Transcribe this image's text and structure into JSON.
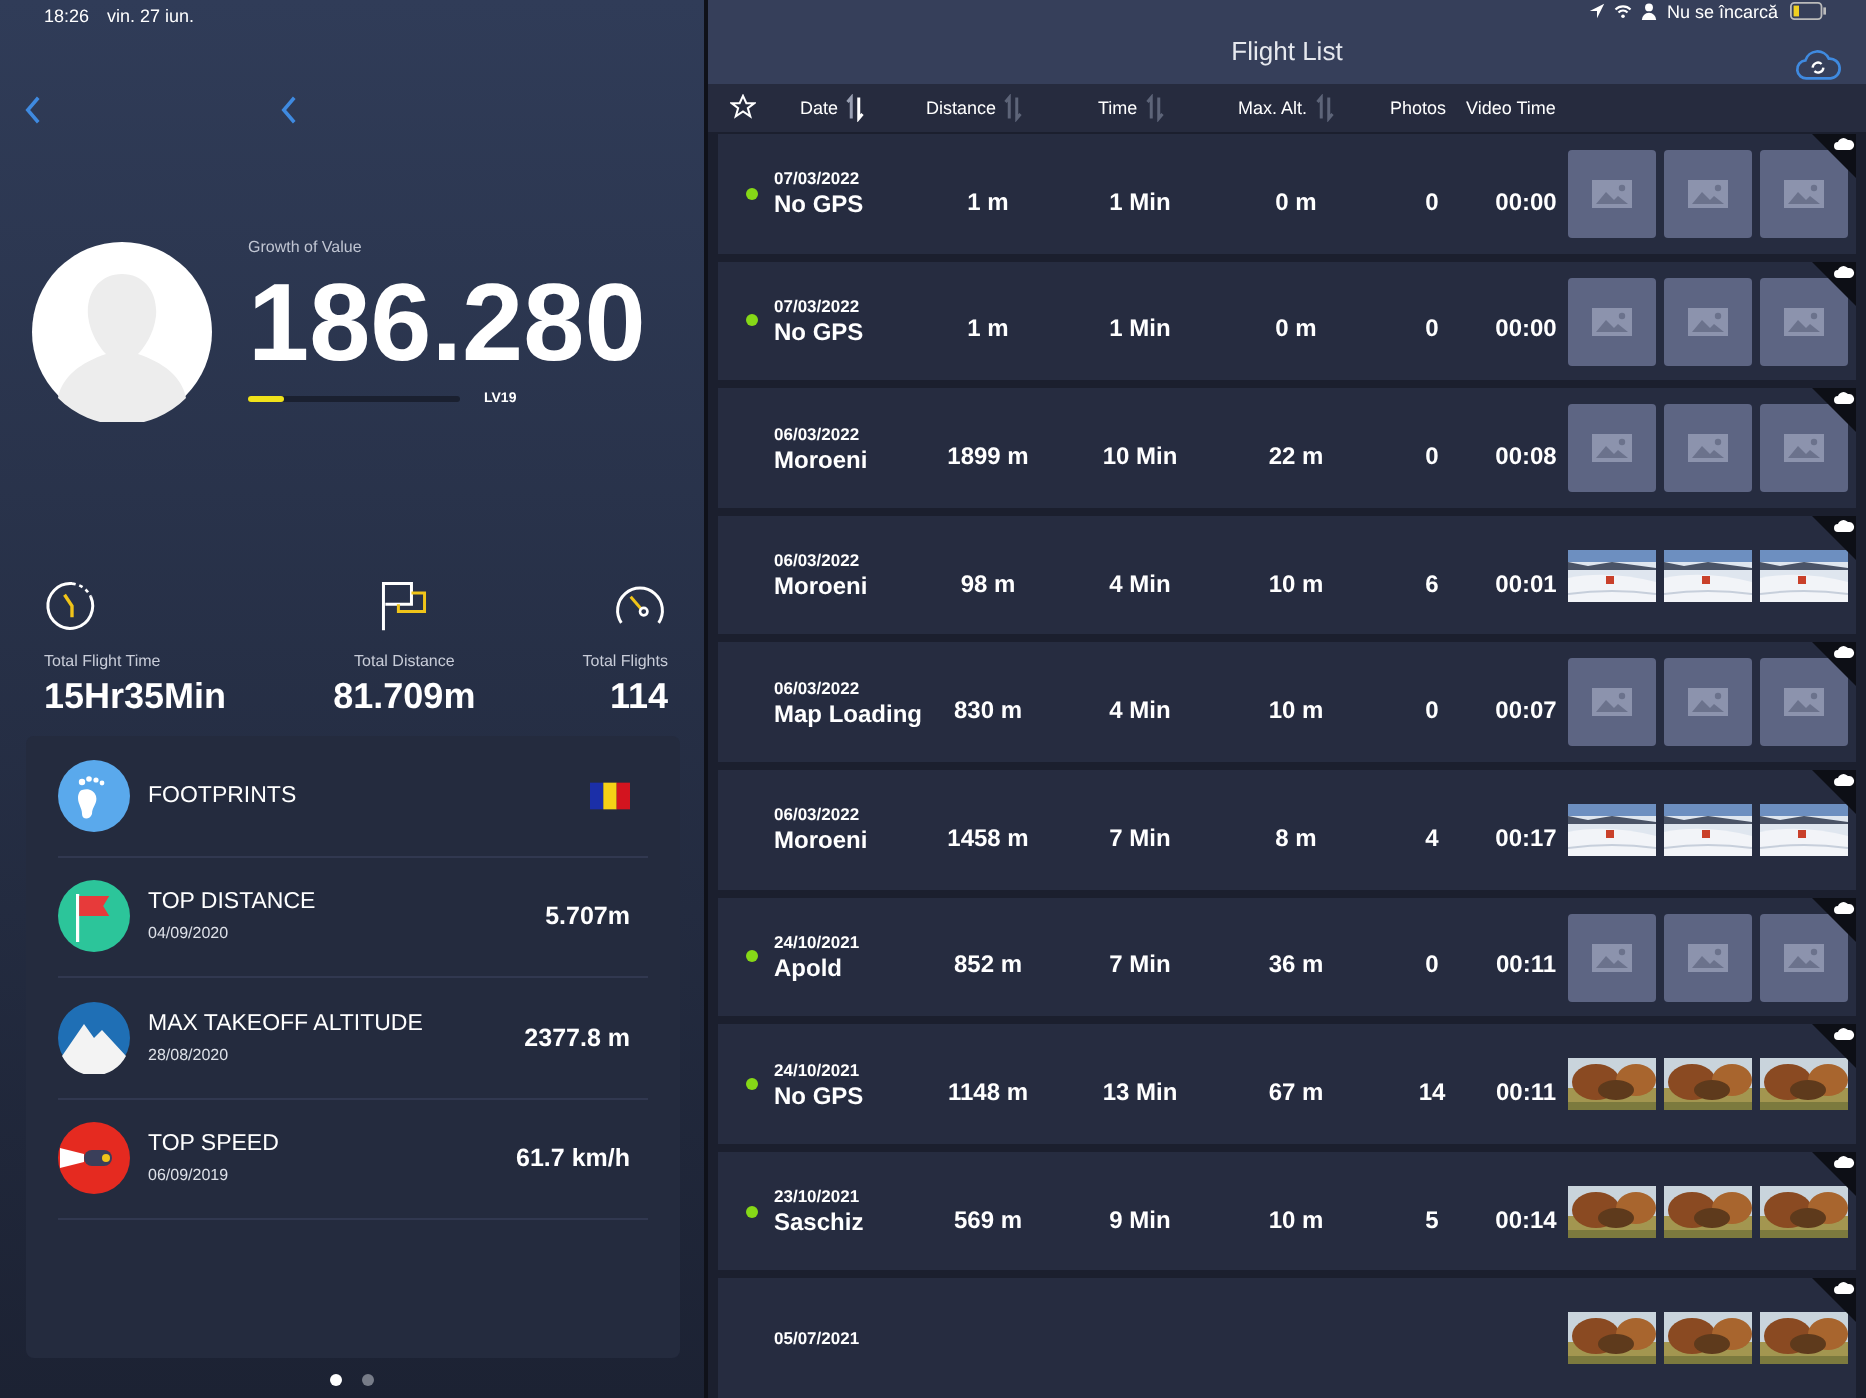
{
  "status_bar": {
    "time": "18:26",
    "date": "vin. 27 iun.",
    "charging": "Nu se încarcă"
  },
  "profile": {
    "caption": "Growth of Value",
    "value": "186.280",
    "level": 0.17,
    "rank": "LV19"
  },
  "stats": [
    {
      "kind": "time",
      "label": "Total Flight Time",
      "value": "15Hr35Min"
    },
    {
      "kind": "distance",
      "label": "Total Distance",
      "value": "81.709m"
    },
    {
      "kind": "flights",
      "label": "Total Flights",
      "value": "114"
    }
  ],
  "records": [
    {
      "kind": "footprints",
      "title": "FOOTPRINTS"
    },
    {
      "kind": "distance",
      "title": "TOP DISTANCE",
      "date": "04/09/2020",
      "value": "5.707m"
    },
    {
      "kind": "altitude",
      "title": "MAX TAKEOFF ALTITUDE",
      "date": "28/08/2020",
      "value": "2377.8 m"
    },
    {
      "kind": "speed",
      "title": "TOP SPEED",
      "date": "06/09/2019",
      "value": "61.7 km/h"
    }
  ],
  "pager": [
    {
      "selected": true
    },
    {
      "selected": false
    }
  ],
  "flight_list": {
    "title": "Flight List",
    "columns": [
      {
        "label": "Date",
        "sortable": true,
        "sorted": true
      },
      {
        "label": "Distance",
        "sortable": true,
        "sorted": false
      },
      {
        "label": "Time",
        "sortable": true,
        "sorted": false
      },
      {
        "label": "Max. Alt.",
        "sortable": true,
        "sorted": false
      },
      {
        "label": "Photos"
      },
      {
        "label": "Video Time"
      }
    ],
    "rows": [
      {
        "date": "07/03/2022",
        "place": "No GPS",
        "gps": true,
        "distance": "1 m",
        "time": "1 Min",
        "alt": "0 m",
        "photos": "0",
        "video": "00:00",
        "thumbs": [
          {
            "photo": false
          },
          {
            "photo": false
          },
          {
            "photo": false
          }
        ]
      },
      {
        "date": "07/03/2022",
        "place": "No GPS",
        "gps": true,
        "distance": "1 m",
        "time": "1 Min",
        "alt": "0 m",
        "photos": "0",
        "video": "00:00",
        "thumbs": [
          {
            "photo": false
          },
          {
            "photo": false
          },
          {
            "photo": false
          }
        ]
      },
      {
        "date": "06/03/2022",
        "place": "Moroeni",
        "gps": false,
        "distance": "1899 m",
        "time": "10 Min",
        "alt": "22 m",
        "photos": "0",
        "video": "00:08",
        "thumbs": [
          {
            "photo": false
          },
          {
            "photo": false
          },
          {
            "photo": false
          }
        ]
      },
      {
        "date": "06/03/2022",
        "place": "Moroeni",
        "gps": false,
        "distance": "98 m",
        "time": "4 Min",
        "alt": "10 m",
        "photos": "6",
        "video": "00:01",
        "thumbs": [
          {
            "photo": true
          },
          {
            "photo": true
          },
          {
            "photo": true
          }
        ]
      },
      {
        "date": "06/03/2022",
        "place": "Map Loading",
        "gps": false,
        "distance": "830 m",
        "time": "4 Min",
        "alt": "10 m",
        "photos": "0",
        "video": "00:07",
        "thumbs": [
          {
            "photo": false
          },
          {
            "photo": false
          },
          {
            "photo": false
          }
        ]
      },
      {
        "date": "06/03/2022",
        "place": "Moroeni",
        "gps": false,
        "distance": "1458 m",
        "time": "7 Min",
        "alt": "8 m",
        "photos": "4",
        "video": "00:17",
        "thumbs": [
          {
            "photo": true
          },
          {
            "photo": true
          },
          {
            "photo": true
          }
        ]
      },
      {
        "date": "24/10/2021",
        "place": "Apold",
        "gps": true,
        "distance": "852 m",
        "time": "7 Min",
        "alt": "36 m",
        "photos": "0",
        "video": "00:11",
        "thumbs": [
          {
            "photo": false
          },
          {
            "photo": false
          },
          {
            "photo": false
          }
        ]
      },
      {
        "date": "24/10/2021",
        "place": "No GPS",
        "gps": true,
        "distance": "1148 m",
        "time": "13 Min",
        "alt": "67 m",
        "photos": "14",
        "video": "00:11",
        "thumbs": [
          {
            "photo": true
          },
          {
            "photo": true
          },
          {
            "photo": true
          }
        ]
      },
      {
        "date": "23/10/2021",
        "place": "Saschiz",
        "gps": true,
        "distance": "569 m",
        "time": "9 Min",
        "alt": "10 m",
        "photos": "5",
        "video": "00:14",
        "thumbs": [
          {
            "photo": true
          },
          {
            "photo": true
          },
          {
            "photo": true
          }
        ]
      },
      {
        "date": "05/07/2021",
        "thumbs": [
          {
            "photo": true
          },
          {
            "photo": true
          },
          {
            "photo": true
          }
        ]
      }
    ]
  }
}
